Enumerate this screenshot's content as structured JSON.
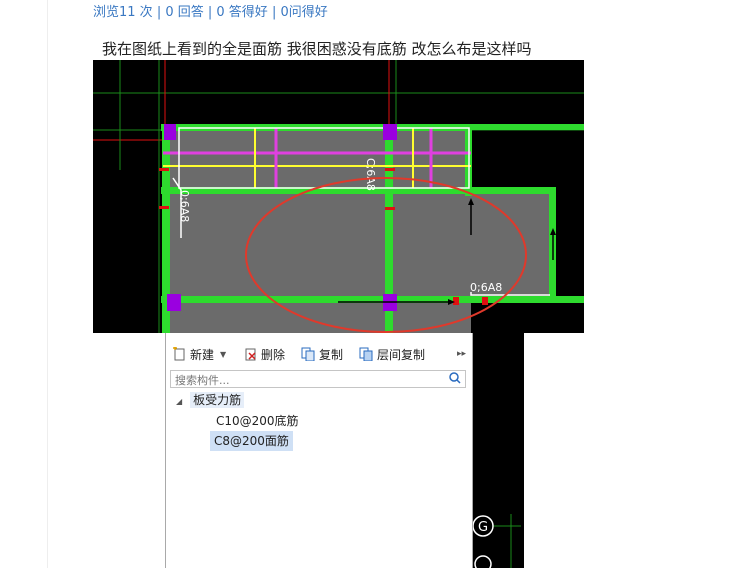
{
  "stats": {
    "views": "浏览11 次",
    "answers": "0 回答",
    "good_answers": "0 答得好",
    "good_questions": "0问得好",
    "sep": " | "
  },
  "question_text": "我在图纸上看到的全是面筋  我很困惑没有底筋 改怎么布是这样吗",
  "cad": {
    "label_left": "0;6A8",
    "label_mid": "C;6A8",
    "label_right": "0;6A8",
    "axis_label": "G",
    "colors": {
      "background": "#000000",
      "slab": "#6b6b6b",
      "beam": "#2edb2e",
      "top_rebar": "#e040e0",
      "marker": "#ffff30",
      "column": "#9a00e0",
      "annotation": "#e0392b",
      "grid": "#e01010"
    }
  },
  "panel": {
    "toolbar": {
      "new_label": "新建",
      "delete_label": "删除",
      "copy_label": "复制",
      "floor_copy_label": "层间复制"
    },
    "search_placeholder": "搜索构件...",
    "tree": {
      "root_label": "板受力筋",
      "items": [
        {
          "label": "C10@200底筋",
          "selected": false
        },
        {
          "label": "C8@200面筋",
          "selected": true
        }
      ]
    }
  }
}
